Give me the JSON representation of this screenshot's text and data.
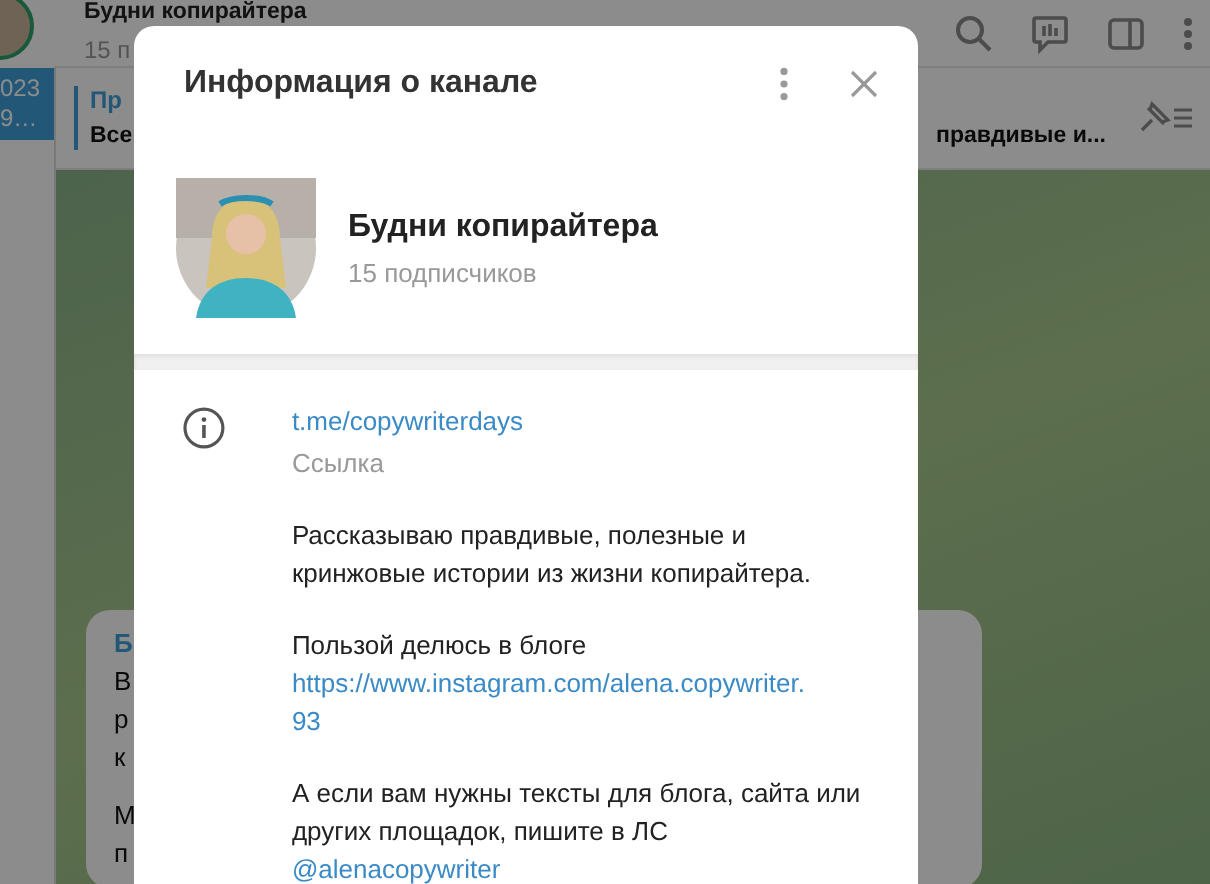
{
  "chat_header": {
    "title": "Будни копирайтера",
    "subtitle": "15 п"
  },
  "chat_list_item": {
    "date": "023",
    "preview": "9…",
    "selected": true
  },
  "pinned_message": {
    "label": "Пр",
    "text_start": "Все",
    "text_end": "правдивые и..."
  },
  "message": {
    "sender": "Б",
    "lines": [
      "В",
      "р",
      "к"
    ],
    "lines_2": [
      "М",
      "п"
    ]
  },
  "dialog": {
    "title": "Информация о канале",
    "channel": {
      "name": "Будни копирайтера",
      "subscribers": "15 подписчиков"
    },
    "link": {
      "url": "t.me/copywriterdays",
      "label": "Ссылка"
    },
    "description": [
      {
        "text": "Рассказываю правдивые, полезные и кринжовые истории из жизни копирайтера."
      },
      {
        "text": "Пользой делюсь в блоге",
        "link": "https://www.instagram.com/alena.copywriter.93"
      },
      {
        "text": "А если вам нужны тексты для блога, сайта или других площадок, пишите в ЛС",
        "link": "@alenacopywriter"
      }
    ]
  }
}
